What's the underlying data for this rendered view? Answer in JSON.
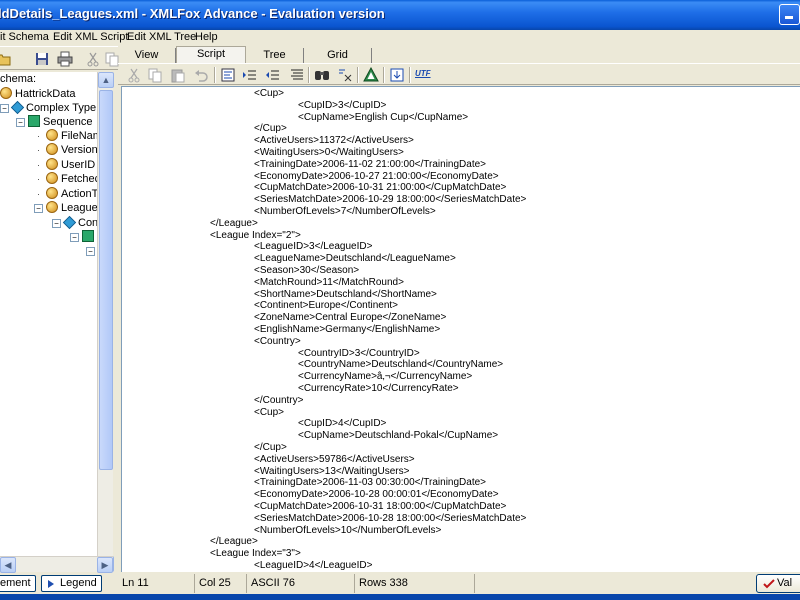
{
  "window": {
    "title": "ldDetails_Leagues.xml - XMLFox Advance - Evaluation version"
  },
  "menu": [
    "it Schema",
    "Edit XML Script",
    "Edit XML Tree",
    "Help"
  ],
  "left_pane": {
    "header": "chema:",
    "tree": [
      {
        "label": "HattrickData",
        "icon": "element-icon",
        "level": 0,
        "expander": "-"
      },
      {
        "label": "Complex Type",
        "icon": "complex-type-icon",
        "level": 1,
        "expander": "-"
      },
      {
        "label": "Sequence",
        "icon": "sequence-icon",
        "level": 2,
        "expander": "-"
      },
      {
        "label": "FileNam",
        "icon": "element-icon",
        "level": 3,
        "expander": ""
      },
      {
        "label": "Version",
        "icon": "element-icon",
        "level": 3,
        "expander": ""
      },
      {
        "label": "UserID",
        "icon": "element-icon",
        "level": 3,
        "expander": ""
      },
      {
        "label": "Fetchec",
        "icon": "element-icon",
        "level": 3,
        "expander": ""
      },
      {
        "label": "ActionT",
        "icon": "element-icon",
        "level": 3,
        "expander": ""
      },
      {
        "label": "League",
        "icon": "element-icon",
        "level": 3,
        "expander": "-"
      },
      {
        "label": "Con",
        "icon": "complex-type-icon",
        "level": 4,
        "expander": "-"
      },
      {
        "label": "",
        "icon": "sequence-icon",
        "level": 5,
        "expander": "-"
      },
      {
        "label": "",
        "icon": "",
        "level": 6,
        "expander": ""
      }
    ],
    "bottom_buttons": [
      "ement",
      "Legend"
    ]
  },
  "tabs": [
    {
      "label": "View",
      "active": false
    },
    {
      "label": "Script",
      "active": true
    },
    {
      "label": "Tree",
      "active": false
    },
    {
      "label": "Grid",
      "active": false
    }
  ],
  "toolbar_right_icons": [
    "cut-icon",
    "copy-icon",
    "paste-icon",
    "undo-icon",
    "format-icon",
    "indent-icon",
    "outdent-icon",
    "align-icon",
    "find-icon",
    "replace-icon",
    "validate-icon",
    "export-icon",
    "utf-icon"
  ],
  "toolbar_right_utf_label": "UTF",
  "editor": {
    "lines": [
      {
        "indent": 2,
        "text": "<Cup>"
      },
      {
        "indent": 3,
        "text": "<CupID>3</CupID>"
      },
      {
        "indent": 3,
        "text": "<CupName>English Cup</CupName>"
      },
      {
        "indent": 2,
        "text": "</Cup>"
      },
      {
        "indent": 2,
        "text": "<ActiveUsers>11372</ActiveUsers>"
      },
      {
        "indent": 2,
        "text": "<WaitingUsers>0</WaitingUsers>"
      },
      {
        "indent": 2,
        "text": "<TrainingDate>2006-11-02 21:00:00</TrainingDate>"
      },
      {
        "indent": 2,
        "text": "<EconomyDate>2006-10-27 21:00:00</EconomyDate>"
      },
      {
        "indent": 2,
        "text": "<CupMatchDate>2006-10-31 21:00:00</CupMatchDate>"
      },
      {
        "indent": 2,
        "text": "<SeriesMatchDate>2006-10-29 18:00:00</SeriesMatchDate>"
      },
      {
        "indent": 2,
        "text": "<NumberOfLevels>7</NumberOfLevels>"
      },
      {
        "indent": 1,
        "text": "</League>"
      },
      {
        "indent": 1,
        "text": "<League Index=\"2\">"
      },
      {
        "indent": 2,
        "text": "<LeagueID>3</LeagueID>"
      },
      {
        "indent": 2,
        "text": "<LeagueName>Deutschland</LeagueName>"
      },
      {
        "indent": 2,
        "text": "<Season>30</Season>"
      },
      {
        "indent": 2,
        "text": "<MatchRound>11</MatchRound>"
      },
      {
        "indent": 2,
        "text": "<ShortName>Deutschland</ShortName>"
      },
      {
        "indent": 2,
        "text": "<Continent>Europe</Continent>"
      },
      {
        "indent": 2,
        "text": "<ZoneName>Central Europe</ZoneName>"
      },
      {
        "indent": 2,
        "text": "<EnglishName>Germany</EnglishName>"
      },
      {
        "indent": 2,
        "text": "<Country>"
      },
      {
        "indent": 3,
        "text": "<CountryID>3</CountryID>"
      },
      {
        "indent": 3,
        "text": "<CountryName>Deutschland</CountryName>"
      },
      {
        "indent": 3,
        "text": "<CurrencyName>â‚¬</CurrencyName>"
      },
      {
        "indent": 3,
        "text": "<CurrencyRate>10</CurrencyRate>"
      },
      {
        "indent": 2,
        "text": "</Country>"
      },
      {
        "indent": 2,
        "text": "<Cup>"
      },
      {
        "indent": 3,
        "text": "<CupID>4</CupID>"
      },
      {
        "indent": 3,
        "text": "<CupName>Deutschland-Pokal</CupName>"
      },
      {
        "indent": 2,
        "text": "</Cup>"
      },
      {
        "indent": 2,
        "text": "<ActiveUsers>59786</ActiveUsers>"
      },
      {
        "indent": 2,
        "text": "<WaitingUsers>13</WaitingUsers>"
      },
      {
        "indent": 2,
        "text": "<TrainingDate>2006-11-03 00:30:00</TrainingDate>"
      },
      {
        "indent": 2,
        "text": "<EconomyDate>2006-10-28 00:00:01</EconomyDate>"
      },
      {
        "indent": 2,
        "text": "<CupMatchDate>2006-10-31 18:00:00</CupMatchDate>"
      },
      {
        "indent": 2,
        "text": "<SeriesMatchDate>2006-10-28 18:00:00</SeriesMatchDate>"
      },
      {
        "indent": 2,
        "text": "<NumberOfLevels>10</NumberOfLevels>"
      },
      {
        "indent": 1,
        "text": "</League>"
      },
      {
        "indent": 1,
        "text": "<League Index=\"3\">"
      },
      {
        "indent": 2,
        "text": "<LeagueID>4</LeagueID>"
      }
    ]
  },
  "status": {
    "line": "Ln 11",
    "col": "Col 25",
    "ascii": "ASCII 76",
    "rows": "Rows 338",
    "validate_label": "Val"
  },
  "colors": {
    "titlebar": "#0a55d0",
    "window_bg": "#ece9d8",
    "editor_bg": "#ffffff"
  }
}
